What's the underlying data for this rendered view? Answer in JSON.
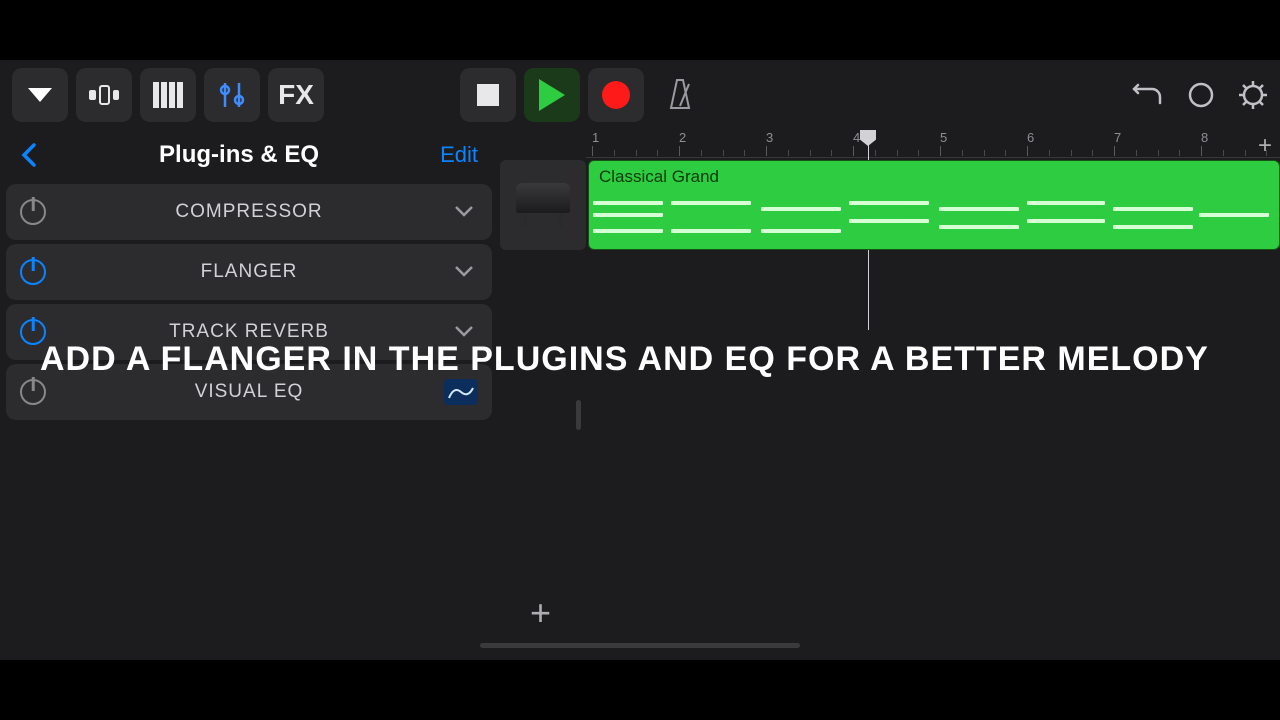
{
  "toolbar": {
    "fx_label": "FX"
  },
  "panel": {
    "title": "Plug-ins & EQ",
    "edit_label": "Edit"
  },
  "plugins": [
    {
      "name": "COMPRESSOR",
      "enabled": false,
      "has_chevron": true
    },
    {
      "name": "FLANGER",
      "enabled": true,
      "has_chevron": true
    },
    {
      "name": "TRACK REVERB",
      "enabled": true,
      "has_chevron": true
    },
    {
      "name": "VISUAL EQ",
      "enabled": false,
      "has_chevron": false
    }
  ],
  "ruler": {
    "bars": [
      "1",
      "2",
      "3",
      "4",
      "5",
      "6",
      "7",
      "8"
    ],
    "playhead_bar": 4.2
  },
  "track": {
    "region_label": "Classical Grand"
  },
  "caption": "ADD A FLANGER IN THE PLUGINS AND EQ FOR A BETTER MELODY",
  "colors": {
    "accent": "#0a84ff",
    "region": "#2ecc40",
    "record": "#ff1a1a"
  }
}
